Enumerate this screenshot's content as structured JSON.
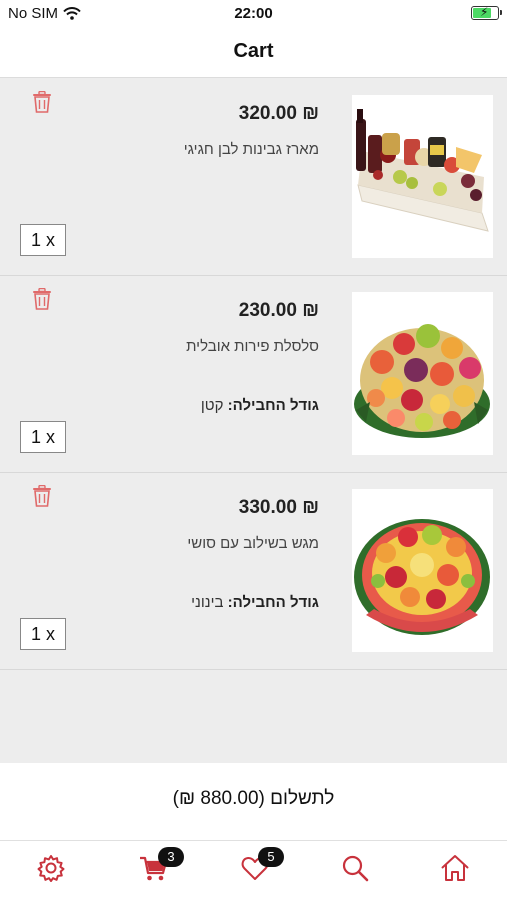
{
  "status_bar": {
    "carrier": "No SIM",
    "time": "22:00",
    "battery_level": 0.8
  },
  "nav": {
    "title": "Cart"
  },
  "cart": {
    "items": [
      {
        "price": "₪ 320.00",
        "name": "מארז גבינות לבן חגיגי",
        "option_label": "",
        "option_value": "",
        "quantity": "1 x",
        "image": "cheese-gift-box"
      },
      {
        "price": "₪ 230.00",
        "name": "סלסלת פירות אובלית",
        "option_label": "גודל החבילה:",
        "option_value": "קטן",
        "quantity": "1 x",
        "image": "oval-fruit-basket"
      },
      {
        "price": "₪ 330.00",
        "name": "מגש בשילוב עם סושי",
        "option_label": "גודל החבילה:",
        "option_value": "בינוני",
        "quantity": "1 x",
        "image": "fruit-sushi-platter"
      }
    ]
  },
  "total": {
    "label": "לתשלום (880.00 ₪)"
  },
  "tab_bar": {
    "cart_badge": "3",
    "favorites_badge": "5",
    "icons": [
      "gear-icon",
      "cart-icon",
      "heart-icon",
      "search-icon",
      "home-icon"
    ]
  },
  "colors": {
    "accent": "#c8323c",
    "trash": "#e06a6a",
    "badge": "#111111"
  }
}
